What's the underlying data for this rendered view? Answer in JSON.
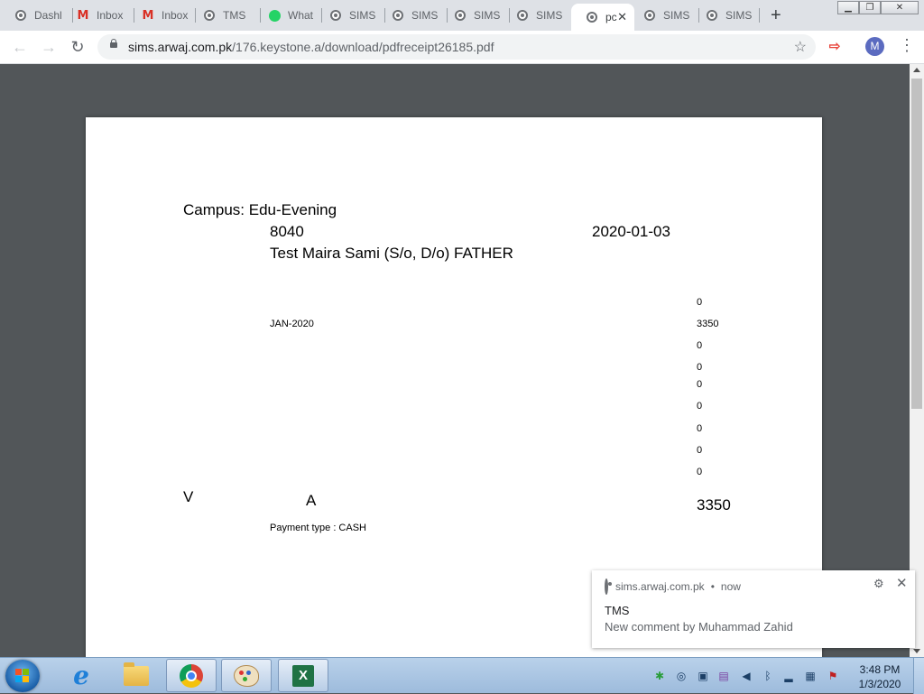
{
  "browser": {
    "tabs": [
      {
        "label": "Dashl",
        "icon": "chrome-favicon"
      },
      {
        "label": "Inbox",
        "icon": "gmail-icon"
      },
      {
        "label": "Inbox",
        "icon": "gmail-icon"
      },
      {
        "label": "TMS",
        "icon": "chrome-favicon"
      },
      {
        "label": "What",
        "icon": "whatsapp-icon"
      },
      {
        "label": "SIMS",
        "icon": "chrome-favicon"
      },
      {
        "label": "SIMS",
        "icon": "chrome-favicon"
      },
      {
        "label": "SIMS",
        "icon": "chrome-favicon"
      },
      {
        "label": "SIMS",
        "icon": "chrome-favicon"
      },
      {
        "label": "pc",
        "icon": "chrome-favicon",
        "active": true
      },
      {
        "label": "SIMS",
        "icon": "chrome-favicon"
      },
      {
        "label": "SIMS",
        "icon": "chrome-favicon"
      }
    ],
    "new_tab": "+",
    "url_host": "sims.arwaj.com.pk",
    "url_path": "/176.keystone.a/download/pdfreceipt26185.pdf",
    "avatar_initial": "M"
  },
  "receipt": {
    "campus": "Campus: Edu-Evening",
    "receipt_no": "8040",
    "date": "2020-01-03",
    "student": "Test Maira Sami (S/o, D/o) FATHER",
    "month": "JAN-2020",
    "amounts": [
      "0",
      "3350",
      "0",
      "0",
      "0",
      "0",
      "0",
      "0",
      "0"
    ],
    "mark_v": "V",
    "mark_a": "A",
    "total": "3350",
    "payment_type": "Payment type : CASH"
  },
  "notification": {
    "source": "sims.arwaj.com.pk",
    "separator": "•",
    "time": "now",
    "title": "TMS",
    "body": "New comment by Muhammad Zahid"
  },
  "taskbar": {
    "time": "3:48 PM",
    "date": "1/3/2020"
  },
  "colors": {
    "viewer_bg": "#525659",
    "accent_avatar": "#5b6bc0",
    "excel": "#1f7244",
    "taskbar": "#b9d1ea"
  }
}
